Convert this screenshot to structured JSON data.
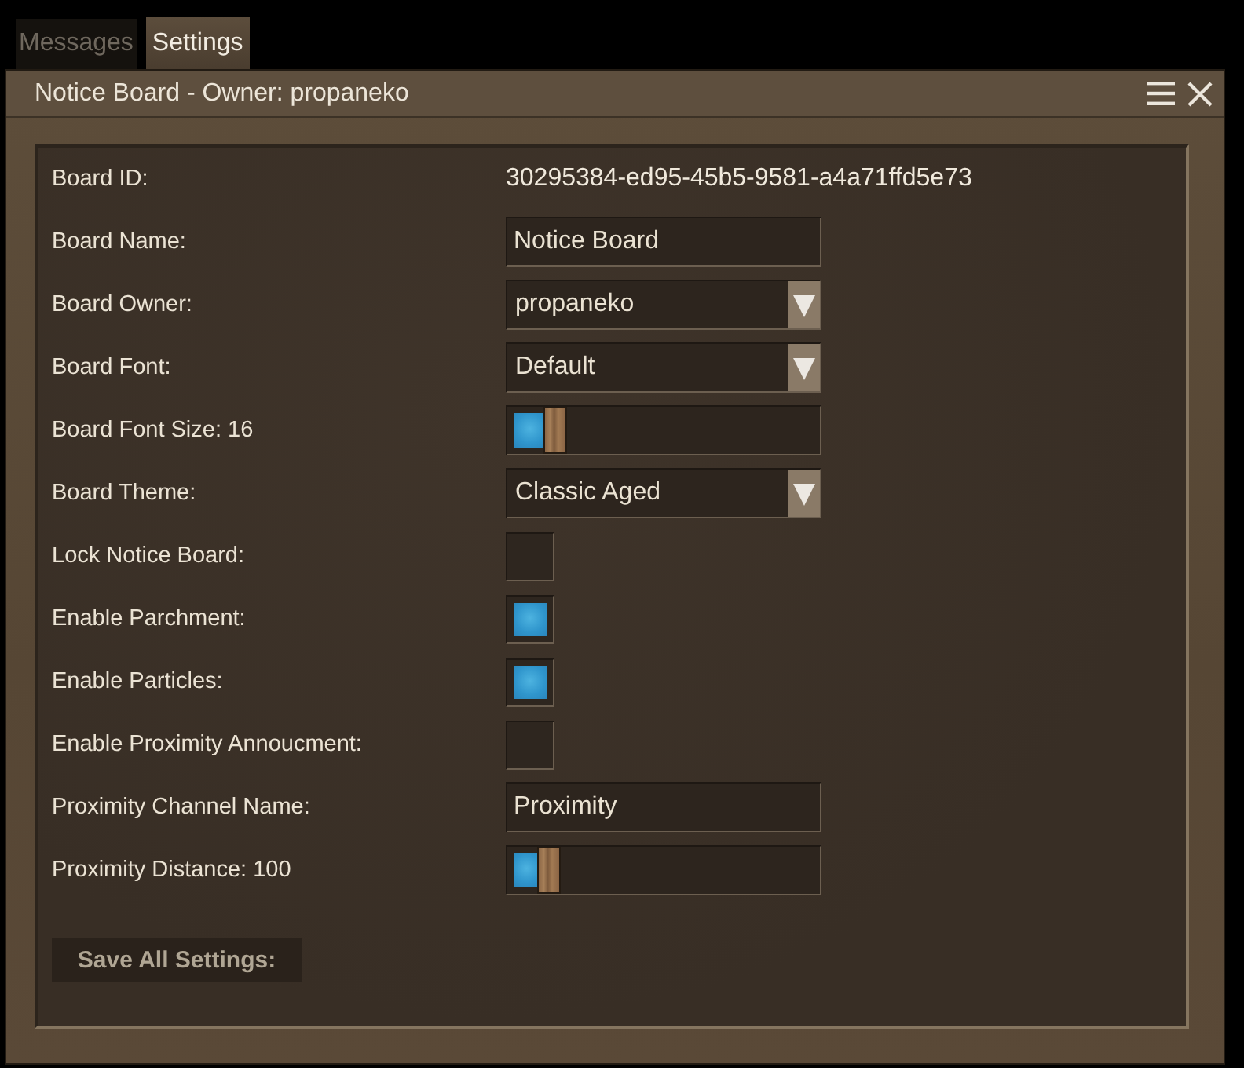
{
  "tabs": [
    {
      "label": "Messages",
      "selected": false
    },
    {
      "label": "Settings",
      "selected": true
    }
  ],
  "window": {
    "title": "Notice Board - Owner: propaneko"
  },
  "settings": [
    {
      "kind": "text",
      "label": "Board ID:",
      "value": "30295384-ed95-45b5-9581-a4a71ffd5e73"
    },
    {
      "kind": "input",
      "label": "Board Name:",
      "value": "Notice Board"
    },
    {
      "kind": "dropdown",
      "label": "Board Owner:",
      "value": "propaneko"
    },
    {
      "kind": "dropdown",
      "label": "Board Font:",
      "value": "Default"
    },
    {
      "kind": "slider",
      "label": "Board Font Size: 16",
      "level": 0.1
    },
    {
      "kind": "dropdown",
      "label": "Board Theme:",
      "value": "Classic Aged"
    },
    {
      "kind": "checkbox",
      "label": "Lock Notice Board:",
      "checked": false
    },
    {
      "kind": "checkbox",
      "label": "Enable Parchment:",
      "checked": true
    },
    {
      "kind": "checkbox",
      "label": "Enable Particles:",
      "checked": true
    },
    {
      "kind": "checkbox",
      "label": "Enable Proximity Annoucment:",
      "checked": false
    },
    {
      "kind": "input",
      "label": "Proximity Channel Name:",
      "value": "Proximity"
    },
    {
      "kind": "slider",
      "label": "Proximity Distance: 100",
      "level": 0.08
    }
  ],
  "save_button": {
    "label": "Save All Settings:"
  }
}
